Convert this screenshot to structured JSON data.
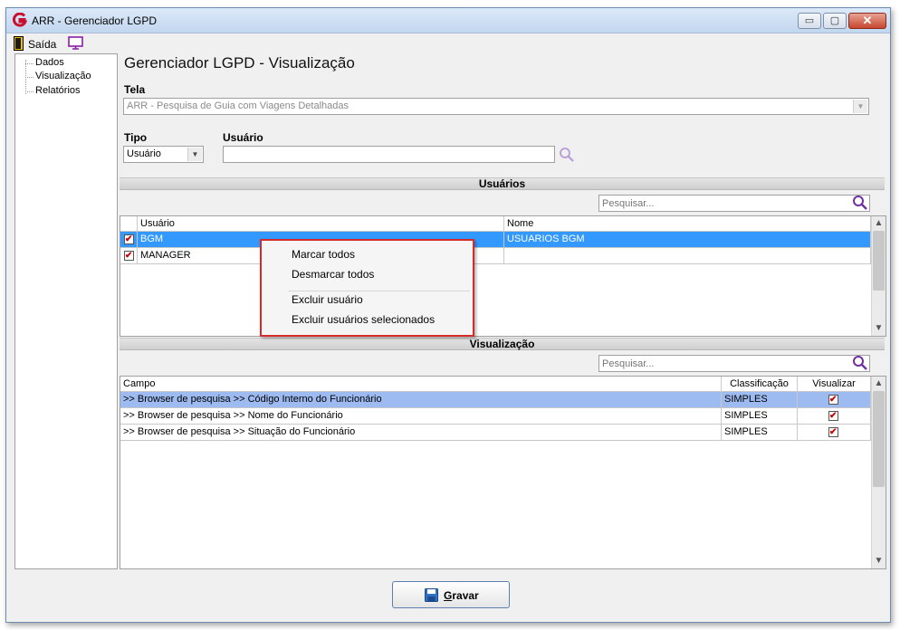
{
  "window": {
    "title": "ARR - Gerenciador LGPD",
    "minimize_glyph": "▭",
    "maximize_glyph": "▢",
    "close_glyph": "✕"
  },
  "toolbar": {
    "exit_label": "Saída"
  },
  "tree": {
    "items": [
      "Dados",
      "Visualização",
      "Relatórios"
    ]
  },
  "page": {
    "title": "Gerenciador LGPD - Visualização"
  },
  "form": {
    "tela_label": "Tela",
    "tela_value": "ARR - Pesquisa de Guia com Viagens Detalhadas",
    "tipo_label": "Tipo",
    "tipo_value": "Usuário",
    "usuario_label": "Usuário",
    "usuario_value": ""
  },
  "usuarios": {
    "section_title": "Usuários",
    "search_placeholder": "Pesquisar...",
    "columns": [
      "Usuário",
      "Nome"
    ],
    "rows": [
      {
        "usuario": "BGM",
        "nome": "USUARIOS BGM",
        "checked": true,
        "selected": true
      },
      {
        "usuario": "MANAGER",
        "nome": "",
        "checked": true,
        "selected": false
      }
    ]
  },
  "visualizacao": {
    "section_title": "Visualização",
    "search_placeholder": "Pesquisar...",
    "columns": [
      "Campo",
      "Classificação",
      "Visualizar"
    ],
    "rows": [
      {
        "campo": ">> Browser de pesquisa >> Código Interno do Funcionário",
        "classificacao": "SIMPLES",
        "visualizar": true,
        "selected": true
      },
      {
        "campo": ">> Browser de pesquisa >> Nome do Funcionário",
        "classificacao": "SIMPLES",
        "visualizar": true,
        "selected": false
      },
      {
        "campo": ">> Browser de pesquisa >> Situação do Funcionário",
        "classificacao": "SIMPLES",
        "visualizar": true,
        "selected": false
      }
    ]
  },
  "context_menu": {
    "items": [
      "Marcar todos",
      "Desmarcar todos",
      "Excluir usuário",
      "Excluir usuários selecionados"
    ]
  },
  "footer": {
    "save_label_prefix": "G",
    "save_label_rest": "ravar"
  },
  "colors": {
    "selection": "#3399ff",
    "selection_light": "#9dbbf0",
    "highlight_border": "#d42a2a",
    "search_icon": "#7030a0"
  }
}
